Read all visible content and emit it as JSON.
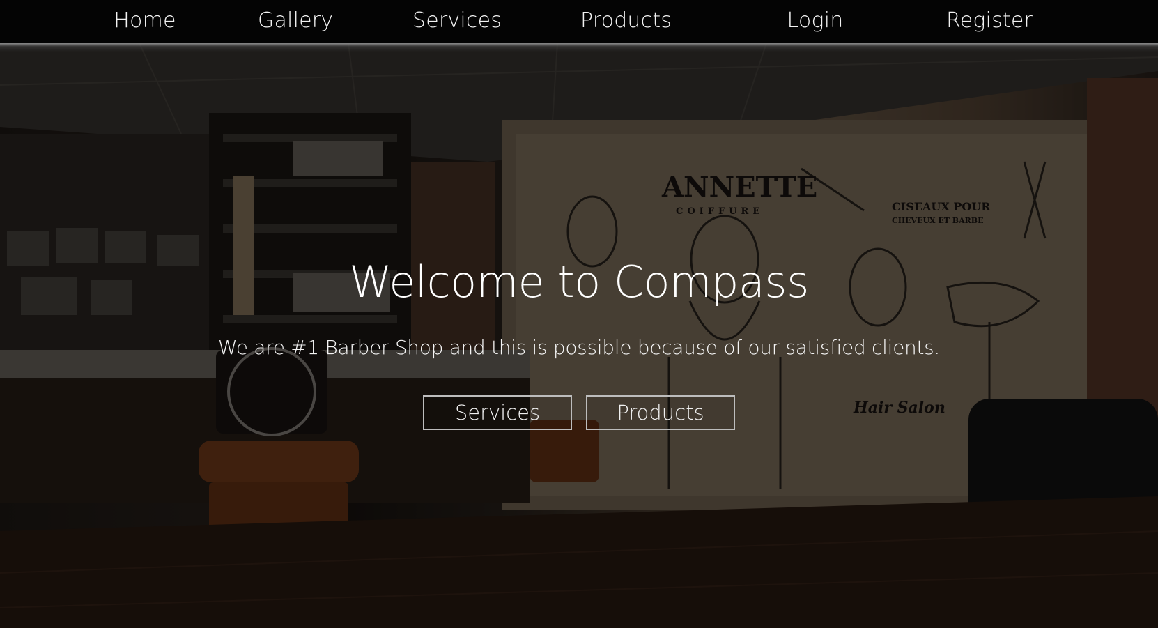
{
  "nav": {
    "items": [
      {
        "label": "Home"
      },
      {
        "label": "Gallery"
      },
      {
        "label": "Services"
      },
      {
        "label": "Products"
      },
      {
        "label": "Login"
      },
      {
        "label": "Register"
      }
    ]
  },
  "hero": {
    "title": "Welcome to Compass",
    "subtitle": "We are #1 Barber Shop and this is possible because of our satisfied clients.",
    "buttons": {
      "services_label": "Services",
      "products_label": "Products"
    },
    "wall_text": {
      "sign_main": "ANNETTE",
      "sign_sub": "COIFFURE",
      "slogan_line1": "CISEAUX POUR",
      "slogan_line2": "CHEVEUX ET BARBE",
      "hair_salon": "Hair Salon"
    }
  },
  "colors": {
    "nav_background": "#040404",
    "nav_text": "#f2f2f2",
    "button_border": "#bdbdbd",
    "overlay": "rgba(0,0,0,0.48)"
  }
}
